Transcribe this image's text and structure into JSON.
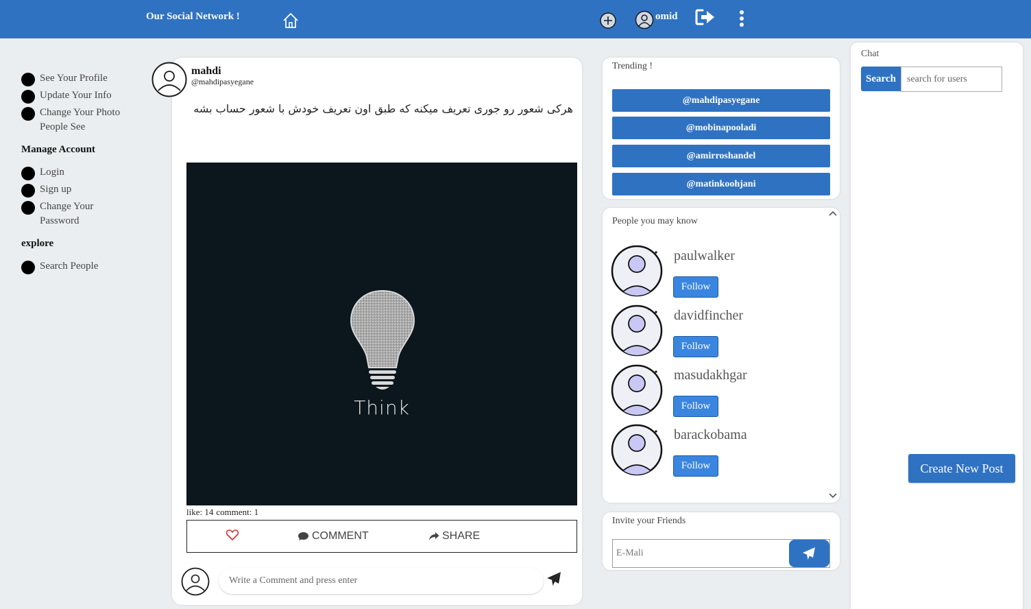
{
  "topbar": {
    "brand": "Our Social Network !",
    "username": "omid",
    "icons": [
      "home-icon",
      "add-icon",
      "user-avatar-icon",
      "logout-icon",
      "more-vertical-icon"
    ]
  },
  "sidebar": {
    "profile_items": [
      {
        "label": "See Your Profile"
      },
      {
        "label": "Update Your Info"
      },
      {
        "label": "Change Your Photo People See"
      }
    ],
    "manage_heading": "Manage Account",
    "manage_items": [
      {
        "label": "Login"
      },
      {
        "label": "Sign up"
      },
      {
        "label": "Change Your Password"
      }
    ],
    "explore_heading": "explore",
    "explore_items": [
      {
        "label": "Search People"
      }
    ]
  },
  "post": {
    "author_name": "mahdi",
    "author_handle": "@mahdipasyegane",
    "text": "هرکی شعور رو جوری تعریف میکنه که طبق اون تعریف خودش با شعور حساب بشه",
    "image_caption": "Think",
    "likes_label": "like: 14",
    "comments_label": "comment: 1",
    "comment_action": "COMMENT",
    "share_action": "SHARE",
    "comment_placeholder": "Write a Comment and press enter"
  },
  "trending": {
    "title": "Trending !",
    "items": [
      "@mahdipasyegane",
      "@mobinapooladi",
      "@amirroshandel",
      "@matinkoohjani"
    ]
  },
  "people": {
    "title": "People you may know",
    "follow_label": "Follow",
    "items": [
      {
        "name": "paulwalker"
      },
      {
        "name": "davidfincher"
      },
      {
        "name": "masudakhgar"
      },
      {
        "name": "barackobama"
      }
    ]
  },
  "invite": {
    "title": "Invite your Friends",
    "placeholder": "E-Mali"
  },
  "chat": {
    "title": "Chat",
    "search_button": "Search",
    "search_placeholder": "search for users"
  },
  "create_post_label": "Create New Post",
  "colors": {
    "primary": "#2f72c2",
    "follow": "#3a85e0",
    "avatar_fill": "#c9c8f5",
    "background": "#ebeef0",
    "image_bg": "#0c161d"
  }
}
